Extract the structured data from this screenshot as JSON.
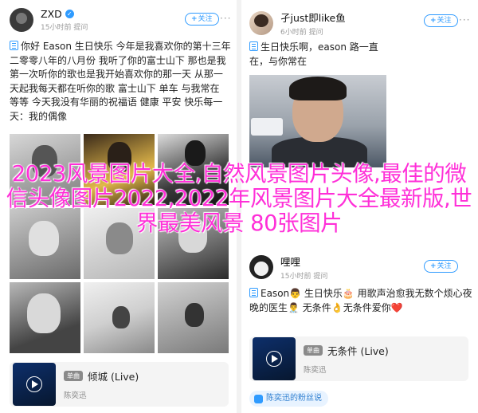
{
  "left_post": {
    "user": {
      "name": "ZXD",
      "sub": "15小时前 提问"
    },
    "follow_label": "关注",
    "text": "你好 Eason 生日快乐 今年是我喜欢你的第十三年 二零零八年的八月份 我听了你的富士山下 那也是我第一次听你的歌也是我开始喜欢你的那一天 从那一天起我每天都在听你的歌 富士山下 单车 与我常在 等等 今天我没有华丽的祝福语 健康 平安 快乐每一天：我的偶像",
    "song_card": {
      "badge": "单曲",
      "title": "倾城 (Live)",
      "artist": "陈奕迅"
    }
  },
  "right_post": {
    "user": {
      "name": "孑just即like鱼",
      "sub": "6小时前 提问"
    },
    "follow_label": "关注",
    "text": "生日快乐啊，eason 路一直在，与你常在"
  },
  "right_post2": {
    "user": {
      "name": "哩哩",
      "sub": "15小时前 提问"
    },
    "follow_label": "关注",
    "text": "Eason👨 生日快乐🎂 用歌声治愈我无数个烦心夜晚的医生👨‍⚕️ 无条件👌无条件爱你❤️",
    "song_card": {
      "badge": "单曲",
      "title": "无条件 (Live)",
      "artist": "陈奕迅"
    },
    "fan_label": "陈奕迅的粉丝说"
  },
  "overlay_title": "2023风景图片大全,自然风景图片头像,最佳的微信头像图片2022,2022年风景图片大全最新版,世界最美风景 80张图片",
  "colors": {
    "accent": "#2f9bff",
    "overlay": "#ff2fd8"
  }
}
